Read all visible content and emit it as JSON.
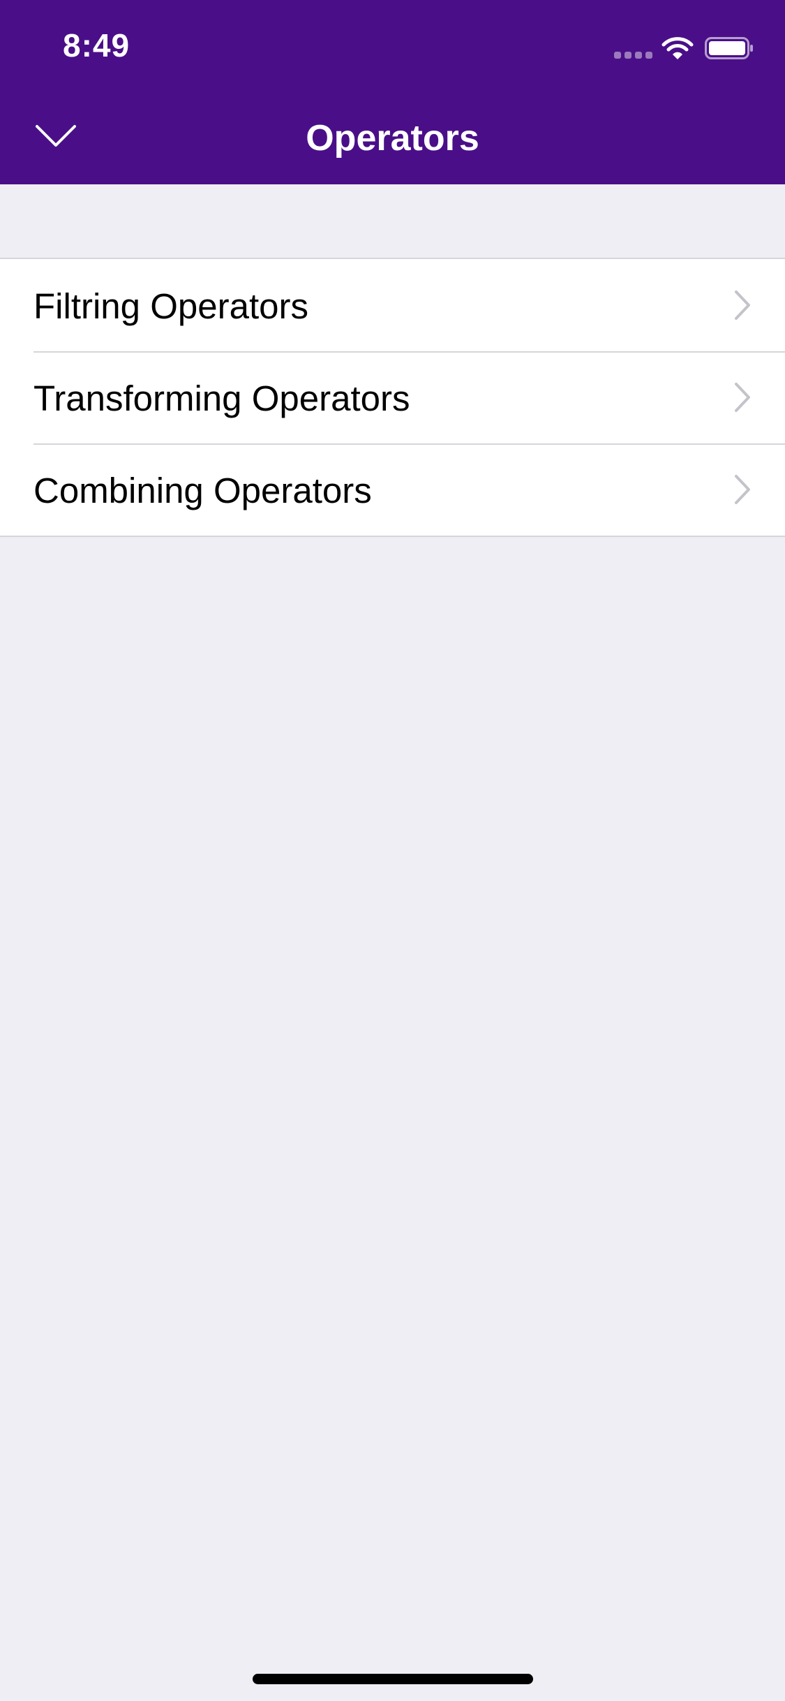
{
  "status_bar": {
    "time": "8:49",
    "signal_icon": "cellular-signal-icon",
    "wifi_icon": "wifi-icon",
    "battery_icon": "battery-icon"
  },
  "nav_bar": {
    "title": "Operators",
    "back_icon": "chevron-down-icon"
  },
  "list": {
    "items": [
      {
        "label": "Filtring Operators",
        "icon": "chevron-right-icon"
      },
      {
        "label": "Transforming Operators",
        "icon": "chevron-right-icon"
      },
      {
        "label": "Combining Operators",
        "icon": "chevron-right-icon"
      }
    ]
  },
  "colors": {
    "header_background": "#4a0f88",
    "page_background": "#efeef4",
    "row_background": "#ffffff",
    "separator": "#d6d5da",
    "chevron": "#c4c3c9"
  }
}
